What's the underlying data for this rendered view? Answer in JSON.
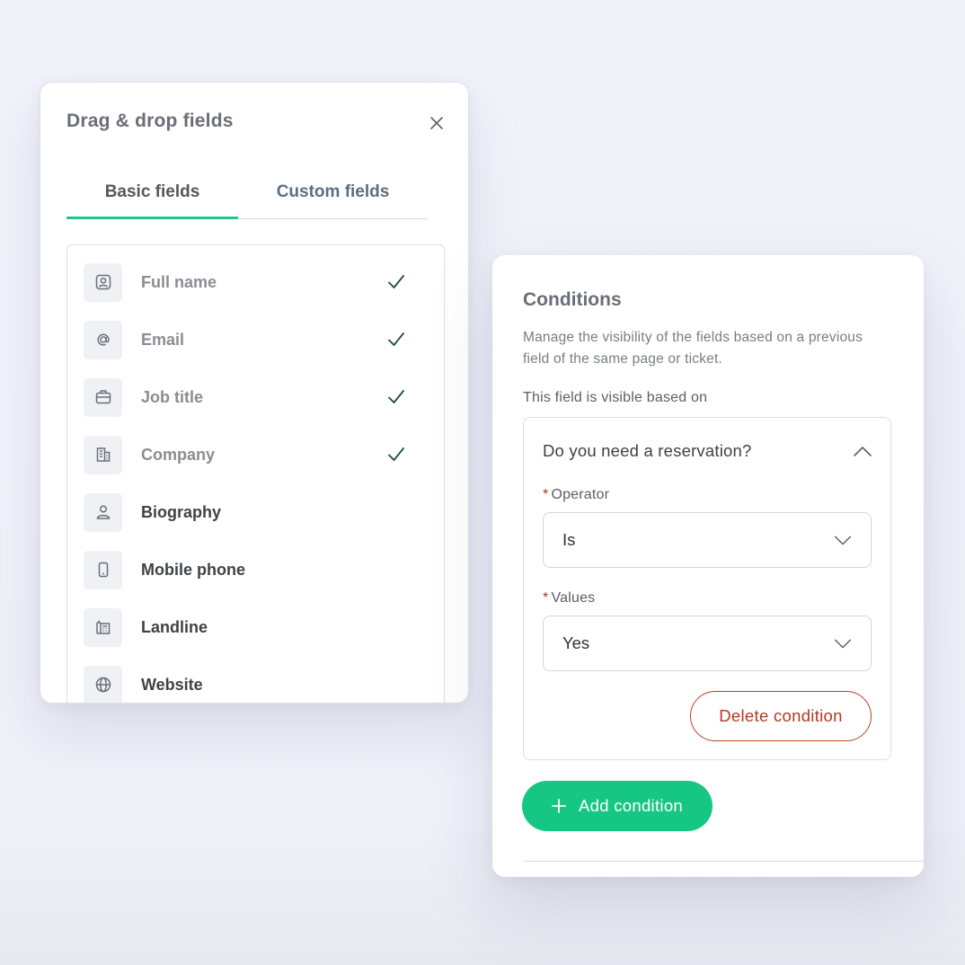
{
  "fields_panel": {
    "title": "Drag & drop fields",
    "tabs": [
      {
        "label": "Basic fields",
        "active": true
      },
      {
        "label": "Custom fields",
        "active": false
      }
    ],
    "fields": [
      {
        "label": "Full name",
        "icon": "user-card-icon",
        "added": true
      },
      {
        "label": "Email",
        "icon": "at-sign-icon",
        "added": true
      },
      {
        "label": "Job title",
        "icon": "briefcase-icon",
        "added": true
      },
      {
        "label": "Company",
        "icon": "building-icon",
        "added": true
      },
      {
        "label": "Biography",
        "icon": "person-icon",
        "added": false
      },
      {
        "label": "Mobile phone",
        "icon": "mobile-phone-icon",
        "added": false
      },
      {
        "label": "Landline",
        "icon": "landline-phone-icon",
        "added": false
      },
      {
        "label": "Website",
        "icon": "globe-icon",
        "added": false
      }
    ]
  },
  "conditions_panel": {
    "title": "Conditions",
    "description": "Manage the visibility of the fields based on a previous field of the same page or ticket.",
    "visible_based_on_label": "This field is visible based on",
    "condition": {
      "question": "Do you need a reservation?",
      "operator_label": "Operator",
      "operator_value": "Is",
      "values_label": "Values",
      "values_value": "Yes",
      "delete_label": "Delete condition"
    },
    "add_label": "Add condition"
  },
  "colors": {
    "accent_green": "#16c784",
    "tab_underline": "#22c788",
    "danger": "#b13a1f",
    "check": "#1f4a45"
  }
}
